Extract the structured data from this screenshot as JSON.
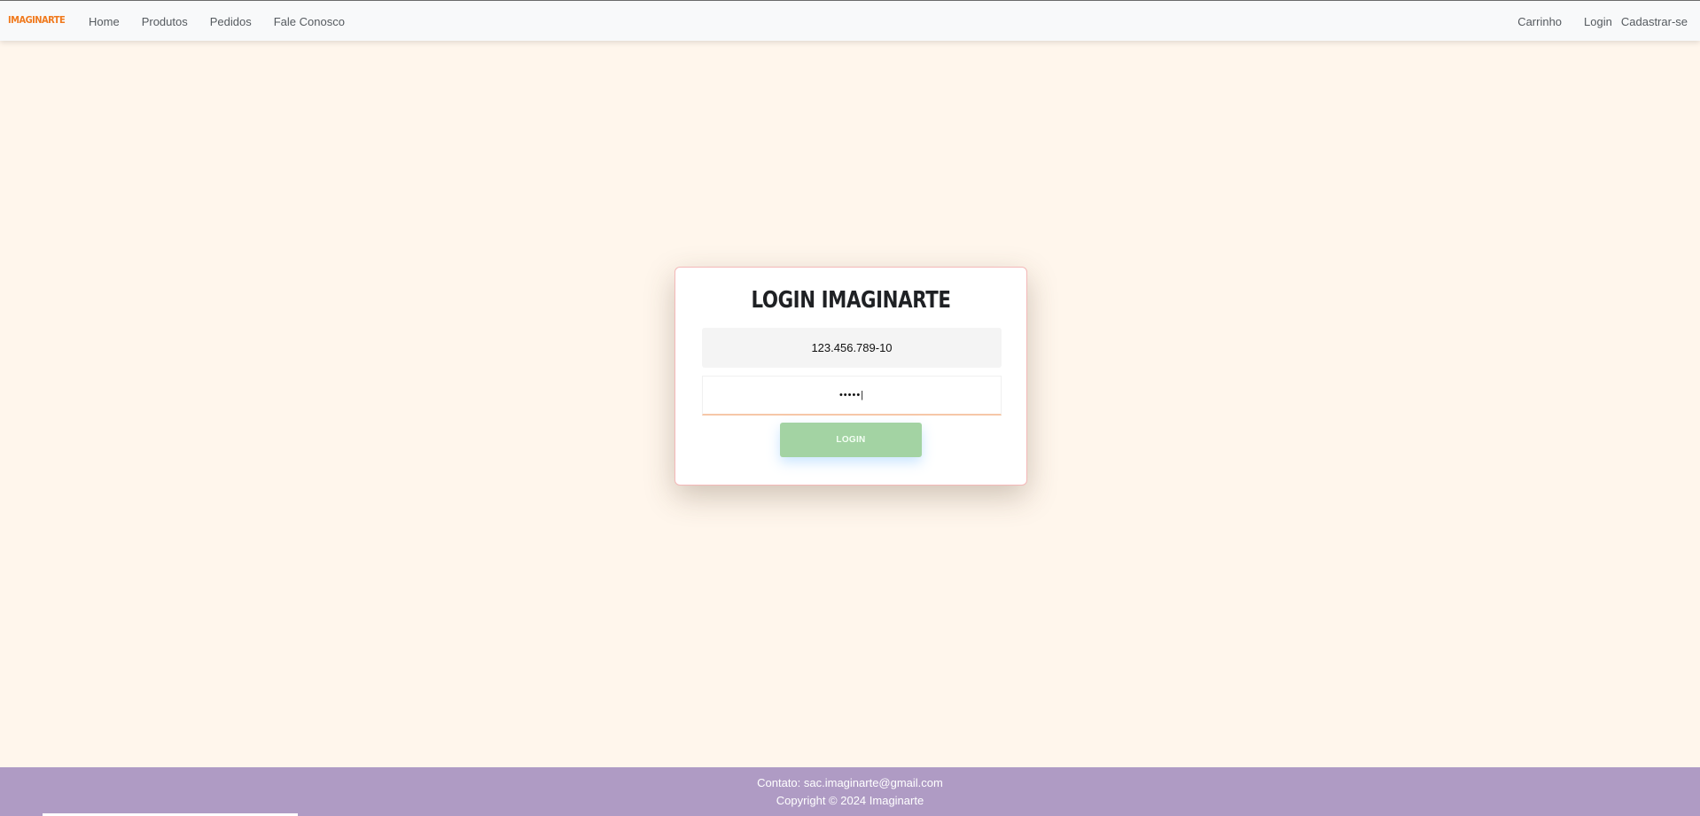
{
  "navbar": {
    "brand": "IMAGINARTE",
    "left_links": [
      "Home",
      "Produtos",
      "Pedidos",
      "Fale Conosco"
    ],
    "right_links": [
      "Carrinho",
      "Login",
      "Cadastrar-se"
    ]
  },
  "login_card": {
    "title": "LOGIN IMAGINARTE",
    "cpf_value": "123.456.789-10",
    "password_value": "•••••|",
    "button_label": "LOGIN"
  },
  "footer": {
    "contact": "Contato: sac.imaginarte@gmail.com",
    "copyright": "Copyright © 2024 Imaginarte"
  },
  "colors": {
    "background": "#fff6ec",
    "brand": "#f07a1e",
    "login_button": "#a3d3a3",
    "footer": "#af9bc4"
  }
}
